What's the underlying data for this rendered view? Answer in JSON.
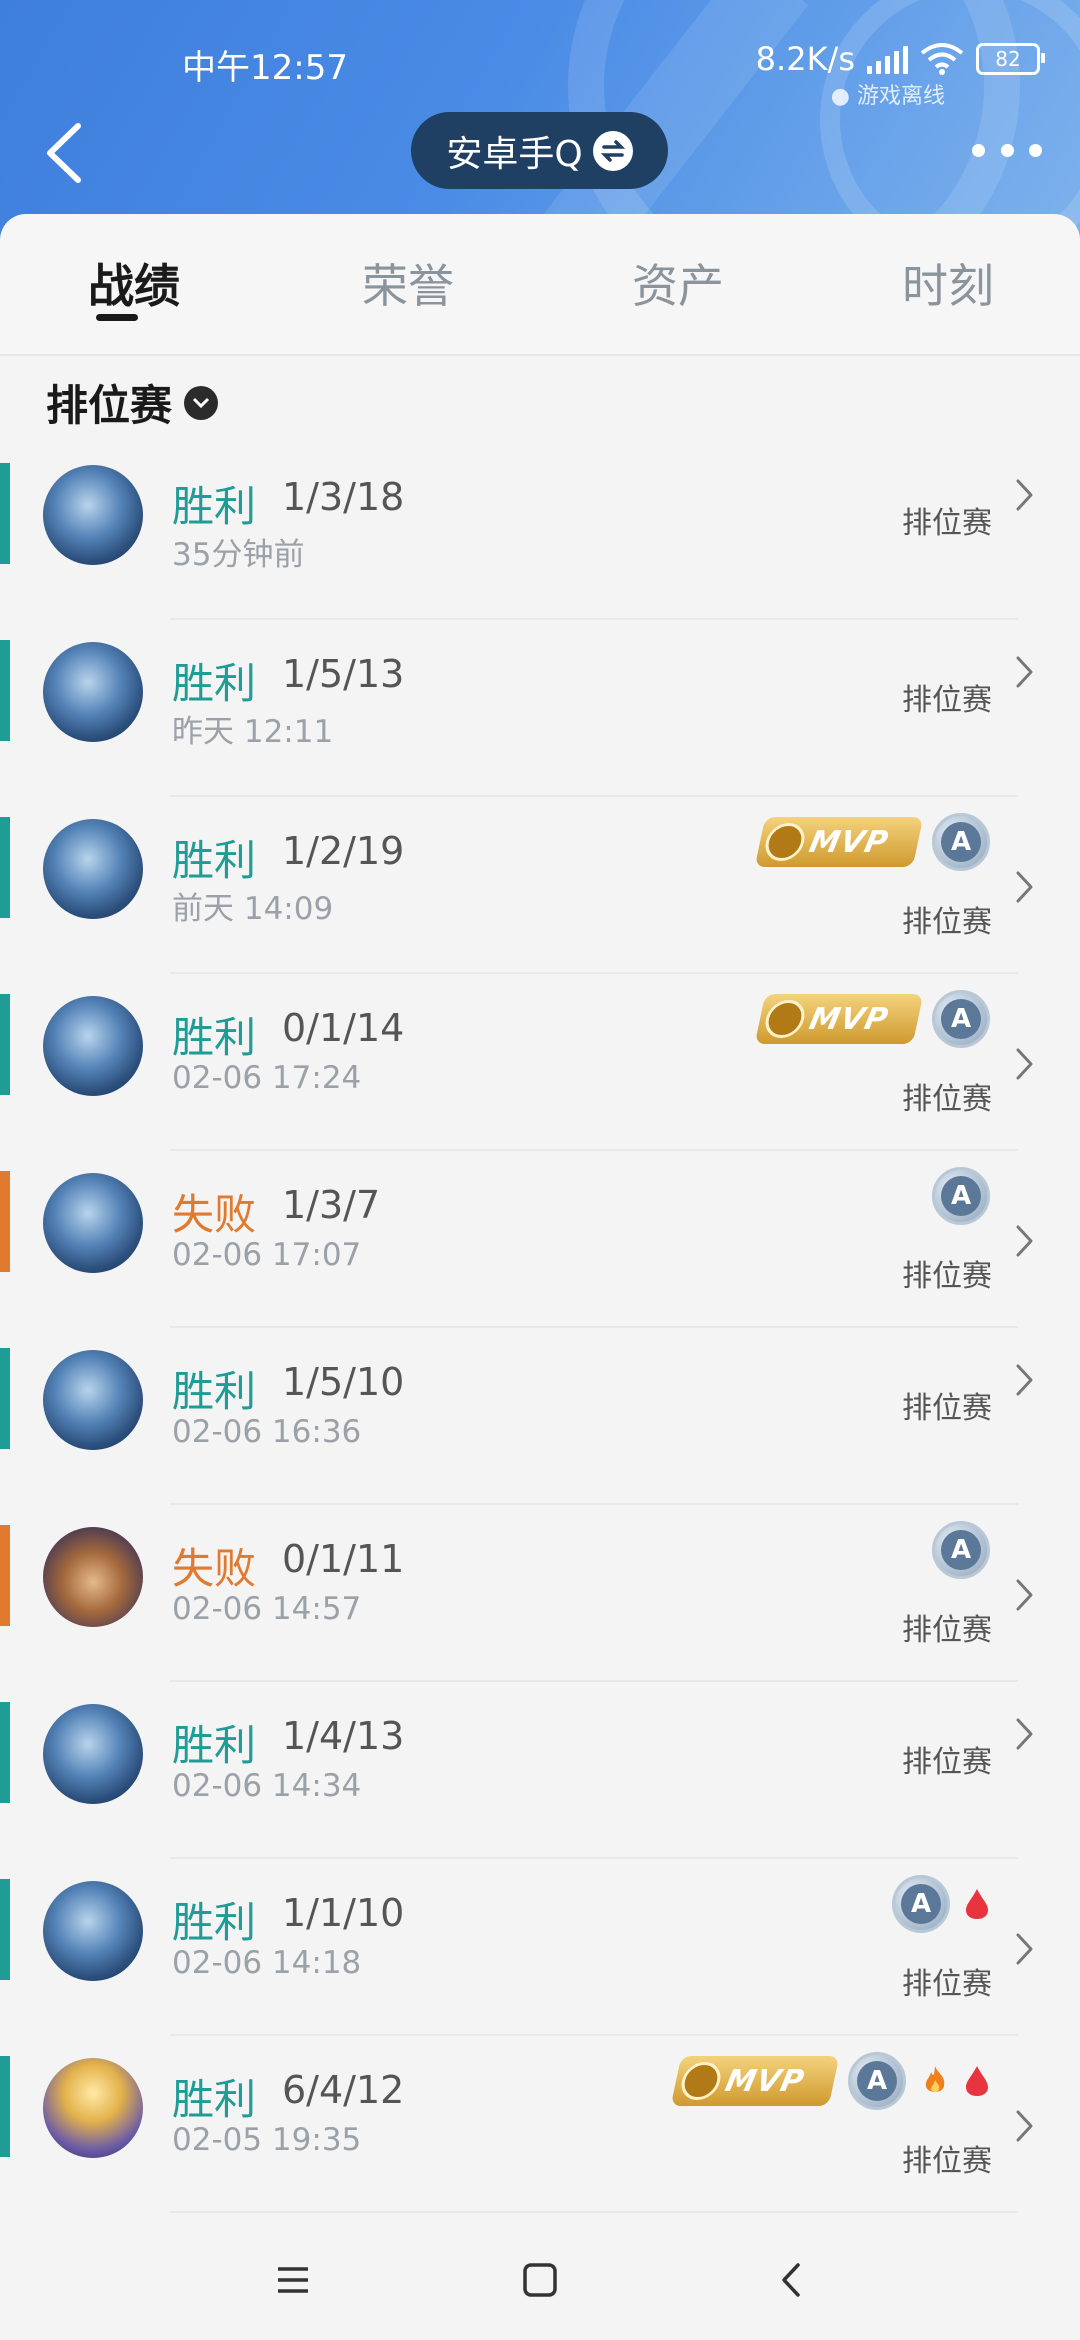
{
  "status_bar": {
    "time": "中午12:57",
    "speed": "8.2K/s",
    "battery": "82",
    "offline": "游戏离线"
  },
  "header": {
    "title": "安卓手Q"
  },
  "tabs": [
    {
      "label": "战绩",
      "active": true
    },
    {
      "label": "荣誉",
      "active": false
    },
    {
      "label": "资产",
      "active": false
    },
    {
      "label": "时刻",
      "active": false
    }
  ],
  "filter": {
    "label": "排位赛"
  },
  "colors": {
    "win": "#1e9c95",
    "loss": "#e07a2f"
  },
  "matches": [
    {
      "result": "胜利",
      "kda": "1/3/18",
      "time": "35分钟前",
      "mode": "排位赛",
      "win": true,
      "mvp": false,
      "grade": false,
      "blood": false,
      "fire": false,
      "hero": "blue"
    },
    {
      "result": "胜利",
      "kda": "1/5/13",
      "time": "昨天 12:11",
      "mode": "排位赛",
      "win": true,
      "mvp": false,
      "grade": false,
      "blood": false,
      "fire": false,
      "hero": "blue"
    },
    {
      "result": "胜利",
      "kda": "1/2/19",
      "time": "前天 14:09",
      "mode": "排位赛",
      "win": true,
      "mvp": true,
      "grade": true,
      "blood": false,
      "fire": false,
      "hero": "blue"
    },
    {
      "result": "胜利",
      "kda": "0/1/14",
      "time": "02-06 17:24",
      "mode": "排位赛",
      "win": true,
      "mvp": true,
      "grade": true,
      "blood": false,
      "fire": false,
      "hero": "blue"
    },
    {
      "result": "失败",
      "kda": "1/3/7",
      "time": "02-06 17:07",
      "mode": "排位赛",
      "win": false,
      "mvp": false,
      "grade": true,
      "blood": false,
      "fire": false,
      "hero": "blue"
    },
    {
      "result": "胜利",
      "kda": "1/5/10",
      "time": "02-06 16:36",
      "mode": "排位赛",
      "win": true,
      "mvp": false,
      "grade": false,
      "blood": false,
      "fire": false,
      "hero": "blue"
    },
    {
      "result": "失败",
      "kda": "0/1/11",
      "time": "02-06 14:57",
      "mode": "排位赛",
      "win": false,
      "mvp": false,
      "grade": true,
      "blood": false,
      "fire": false,
      "hero": "brown"
    },
    {
      "result": "胜利",
      "kda": "1/4/13",
      "time": "02-06 14:34",
      "mode": "排位赛",
      "win": true,
      "mvp": false,
      "grade": false,
      "blood": false,
      "fire": false,
      "hero": "blue"
    },
    {
      "result": "胜利",
      "kda": "1/1/10",
      "time": "02-06 14:18",
      "mode": "排位赛",
      "win": true,
      "mvp": false,
      "grade": true,
      "blood": true,
      "fire": false,
      "hero": "blue"
    },
    {
      "result": "胜利",
      "kda": "6/4/12",
      "time": "02-05 19:35",
      "mode": "排位赛",
      "win": true,
      "mvp": true,
      "grade": true,
      "blood": true,
      "fire": true,
      "hero": "gold"
    }
  ],
  "badges": {
    "mvp": "MVP",
    "grade": "A"
  }
}
